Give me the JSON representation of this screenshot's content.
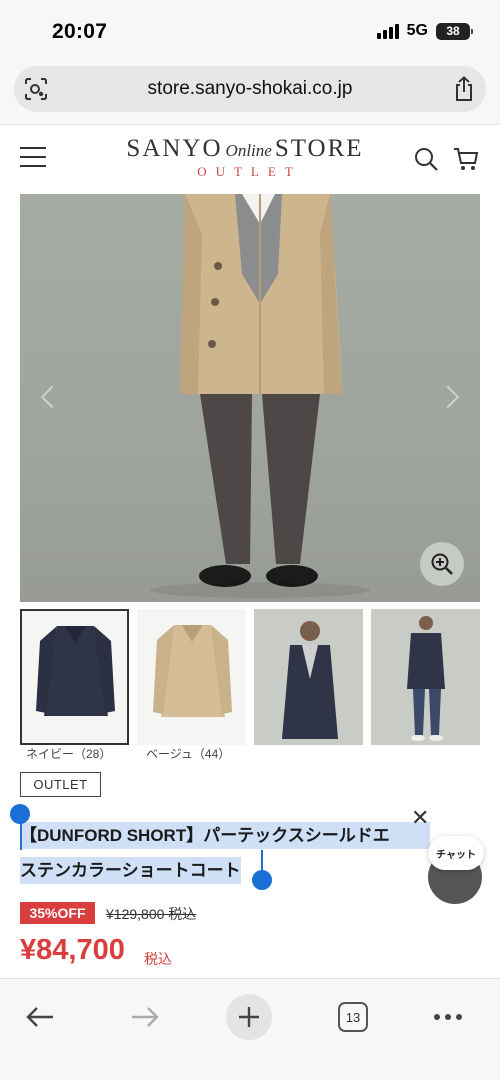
{
  "status_bar": {
    "time": "20:07",
    "network": "5G",
    "battery": "38"
  },
  "browser": {
    "url": "store.sanyo-shokai.co.jp",
    "tabs_count": "13"
  },
  "header": {
    "logo_left": "SANYO",
    "logo_online": "Online",
    "logo_right": "STORE",
    "logo_sub": "OUTLET"
  },
  "gallery": {
    "swatches": [
      {
        "label": "ネイビー（28）",
        "color": "#2f3447"
      },
      {
        "label": "ベージュ（44）",
        "color": "#cdb58e"
      }
    ]
  },
  "product": {
    "badge": "OUTLET",
    "title_line1": "【DUNFORD SHORT】パーテックスシールドエ",
    "title_line2": "ステンカラーショートコート",
    "title_more": "…",
    "discount": "35%OFF",
    "original_price": "¥129,800 税込",
    "price": "¥84,700",
    "price_tax": "税込"
  },
  "chat": {
    "label": "チャット",
    "close": "✕"
  },
  "colors": {
    "accent_red": "#d93d3d",
    "selection": "#1c6fd4",
    "highlight": "#cfe0f6"
  }
}
